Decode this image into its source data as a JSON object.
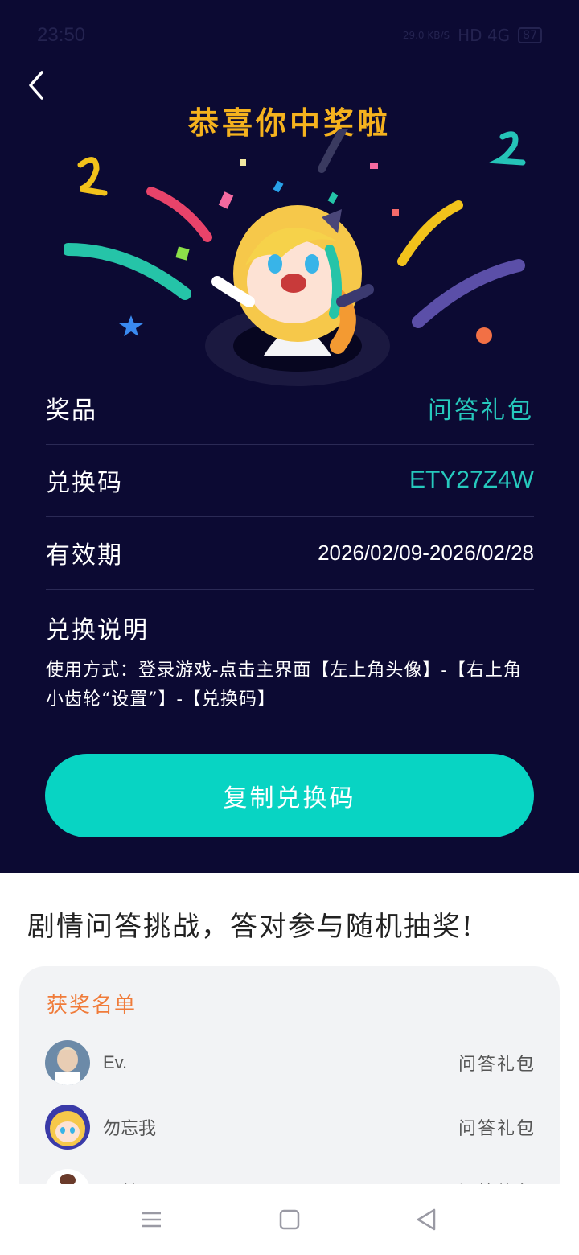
{
  "status_bar": {
    "time": "23:50",
    "speed": "29.0 KB/S",
    "network": "HD 4G",
    "battery": "87"
  },
  "header": {
    "title": "恭喜你中奖啦"
  },
  "prize": {
    "rows": [
      {
        "label": "奖品",
        "value": "问答礼包"
      },
      {
        "label": "兑换码",
        "value": "ETY27Z4W"
      },
      {
        "label": "有效期",
        "value": "2026/02/09-2026/02/28"
      }
    ],
    "instructions_title": "兑换说明",
    "instructions_text": "使用方式：登录游戏-点击主界面【左上角头像】-【右上角小齿轮“设置”】-【兑换码】",
    "copy_button": "复制兑换码"
  },
  "challenge": {
    "headline": "剧情问答挑战，答对参与随机抽奖!"
  },
  "winners": {
    "title": "获奖名单",
    "list": [
      {
        "name": "Ev.",
        "prize": "问答礼包"
      },
      {
        "name": "勿忘我",
        "prize": "问答礼包"
      },
      {
        "name": "贝龄",
        "prize": "问答礼包"
      }
    ]
  },
  "colors": {
    "background": "#0c0a33",
    "accent": "#08d4c3",
    "title": "#f5b21e",
    "winners_title": "#f07b39"
  }
}
